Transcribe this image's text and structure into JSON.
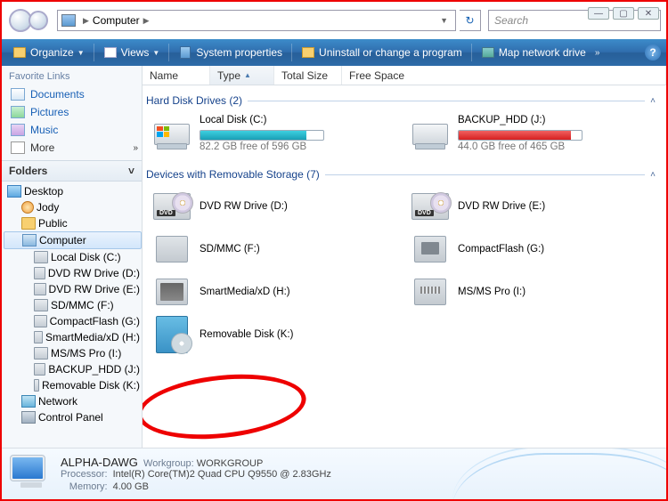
{
  "window_controls": {
    "min": "—",
    "max": "▢",
    "close": "✕"
  },
  "address": {
    "location": "Computer"
  },
  "search": {
    "placeholder": "Search"
  },
  "toolbar": {
    "organize": "Organize",
    "views": "Views",
    "props": "System properties",
    "uninstall": "Uninstall or change a program",
    "mapnet": "Map network drive",
    "more": "»"
  },
  "sidebar": {
    "fav_header": "Favorite Links",
    "favorites": [
      {
        "label": "Documents"
      },
      {
        "label": "Pictures"
      },
      {
        "label": "Music"
      },
      {
        "label": "More"
      }
    ],
    "folders_header": "Folders",
    "tree": {
      "desktop": "Desktop",
      "user": "Jody",
      "public": "Public",
      "computer": "Computer",
      "drives": [
        "Local Disk (C:)",
        "DVD RW Drive (D:)",
        "DVD RW Drive (E:)",
        "SD/MMC (F:)",
        "CompactFlash (G:)",
        "SmartMedia/xD (H:)",
        "MS/MS Pro (I:)",
        "BACKUP_HDD (J:)",
        "Removable Disk (K:)"
      ],
      "network": "Network",
      "control": "Control Panel"
    }
  },
  "columns": {
    "name": "Name",
    "type": "Type",
    "size": "Total Size",
    "free": "Free Space"
  },
  "groups": {
    "hdd": {
      "title": "Hard Disk Drives (2)"
    },
    "rem": {
      "title": "Devices with Removable Storage (7)"
    }
  },
  "drives": {
    "c": {
      "name": "Local Disk (C:)",
      "sub": "82.2 GB free of 596 GB",
      "fill": 86
    },
    "j": {
      "name": "BACKUP_HDD (J:)",
      "sub": "44.0 GB free of 465 GB",
      "fill": 91
    },
    "d": {
      "name": "DVD RW Drive (D:)"
    },
    "e": {
      "name": "DVD RW Drive (E:)"
    },
    "f": {
      "name": "SD/MMC (F:)"
    },
    "g": {
      "name": "CompactFlash (G:)"
    },
    "h": {
      "name": "SmartMedia/xD (H:)"
    },
    "i": {
      "name": "MS/MS Pro (I:)"
    },
    "k": {
      "name": "Removable Disk (K:)"
    }
  },
  "details": {
    "name": "ALPHA-DAWG",
    "workgroup_label": "Workgroup:",
    "workgroup": "WORKGROUP",
    "processor_label": "Processor:",
    "processor": "Intel(R) Core(TM)2 Quad CPU    Q9550  @ 2.83GHz",
    "memory_label": "Memory:",
    "memory": "4.00 GB"
  }
}
